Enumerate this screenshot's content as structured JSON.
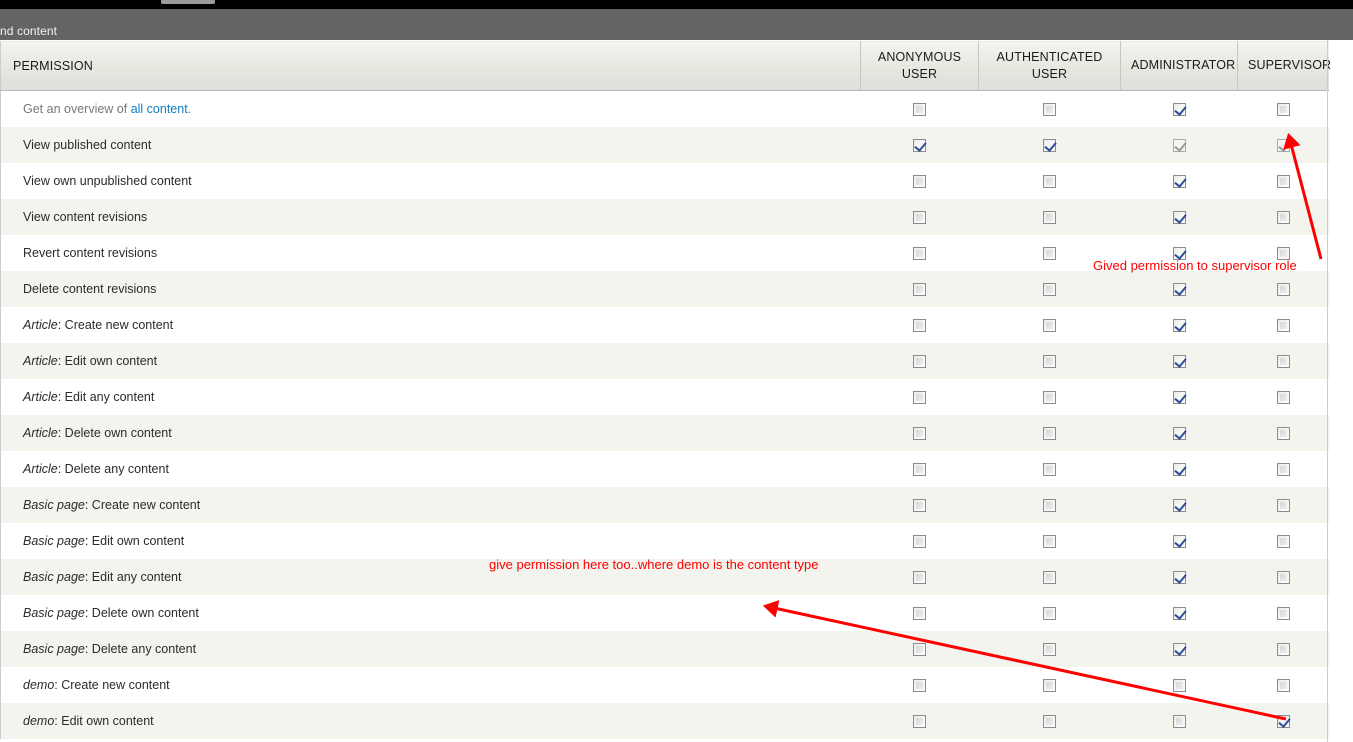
{
  "window": {
    "titlebar_text": "nd content"
  },
  "table": {
    "columns": [
      {
        "id": "permission",
        "label": "PERMISSION"
      },
      {
        "id": "anonymous",
        "label": "ANONYMOUS USER"
      },
      {
        "id": "authenticated",
        "label": "AUTHENTICATED USER"
      },
      {
        "id": "administrator",
        "label": "ADMINISTRATOR"
      },
      {
        "id": "supervisor",
        "label": "SUPERVISOR"
      }
    ],
    "rows": [
      {
        "type_prefix": "",
        "label": "Get an overview of ",
        "link": "all content",
        "suffix": ".",
        "muted": true,
        "anonymous": "unchecked",
        "authenticated": "unchecked",
        "administrator": "checked",
        "supervisor": "unchecked"
      },
      {
        "type_prefix": "",
        "label": "View published content",
        "anonymous": "checked",
        "authenticated": "checked",
        "administrator": "checked-disabled",
        "supervisor": "checked-disabled"
      },
      {
        "type_prefix": "",
        "label": "View own unpublished content",
        "anonymous": "unchecked",
        "authenticated": "unchecked",
        "administrator": "checked",
        "supervisor": "unchecked"
      },
      {
        "type_prefix": "",
        "label": "View content revisions",
        "anonymous": "unchecked",
        "authenticated": "unchecked",
        "administrator": "checked",
        "supervisor": "unchecked"
      },
      {
        "type_prefix": "",
        "label": "Revert content revisions",
        "anonymous": "unchecked",
        "authenticated": "unchecked",
        "administrator": "checked",
        "supervisor": "unchecked"
      },
      {
        "type_prefix": "",
        "label": "Delete content revisions",
        "anonymous": "unchecked",
        "authenticated": "unchecked",
        "administrator": "checked",
        "supervisor": "unchecked"
      },
      {
        "type_prefix": "Article",
        "label": ": Create new content",
        "anonymous": "unchecked",
        "authenticated": "unchecked",
        "administrator": "checked",
        "supervisor": "unchecked"
      },
      {
        "type_prefix": "Article",
        "label": ": Edit own content",
        "anonymous": "unchecked",
        "authenticated": "unchecked",
        "administrator": "checked",
        "supervisor": "unchecked"
      },
      {
        "type_prefix": "Article",
        "label": ": Edit any content",
        "anonymous": "unchecked",
        "authenticated": "unchecked",
        "administrator": "checked",
        "supervisor": "unchecked"
      },
      {
        "type_prefix": "Article",
        "label": ": Delete own content",
        "anonymous": "unchecked",
        "authenticated": "unchecked",
        "administrator": "checked",
        "supervisor": "unchecked"
      },
      {
        "type_prefix": "Article",
        "label": ": Delete any content",
        "anonymous": "unchecked",
        "authenticated": "unchecked",
        "administrator": "checked",
        "supervisor": "unchecked"
      },
      {
        "type_prefix": "Basic page",
        "label": ": Create new content",
        "anonymous": "unchecked",
        "authenticated": "unchecked",
        "administrator": "checked",
        "supervisor": "unchecked"
      },
      {
        "type_prefix": "Basic page",
        "label": ": Edit own content",
        "anonymous": "unchecked",
        "authenticated": "unchecked",
        "administrator": "checked",
        "supervisor": "unchecked"
      },
      {
        "type_prefix": "Basic page",
        "label": ": Edit any content",
        "anonymous": "unchecked",
        "authenticated": "unchecked",
        "administrator": "checked",
        "supervisor": "unchecked"
      },
      {
        "type_prefix": "Basic page",
        "label": ": Delete own content",
        "anonymous": "unchecked",
        "authenticated": "unchecked",
        "administrator": "checked",
        "supervisor": "unchecked"
      },
      {
        "type_prefix": "Basic page",
        "label": ": Delete any content",
        "anonymous": "unchecked",
        "authenticated": "unchecked",
        "administrator": "checked",
        "supervisor": "unchecked"
      },
      {
        "type_prefix": "demo",
        "label": ": Create new content",
        "anonymous": "unchecked",
        "authenticated": "unchecked",
        "administrator": "unchecked",
        "supervisor": "unchecked"
      },
      {
        "type_prefix": "demo",
        "label": ": Edit own content",
        "anonymous": "unchecked",
        "authenticated": "unchecked",
        "administrator": "unchecked",
        "supervisor": "checked"
      }
    ]
  },
  "annotations": {
    "supervisor_note": "Gived permission to supervisor role",
    "demo_note": "give permission here too..where demo is the content type",
    "color": "#ff0000"
  }
}
